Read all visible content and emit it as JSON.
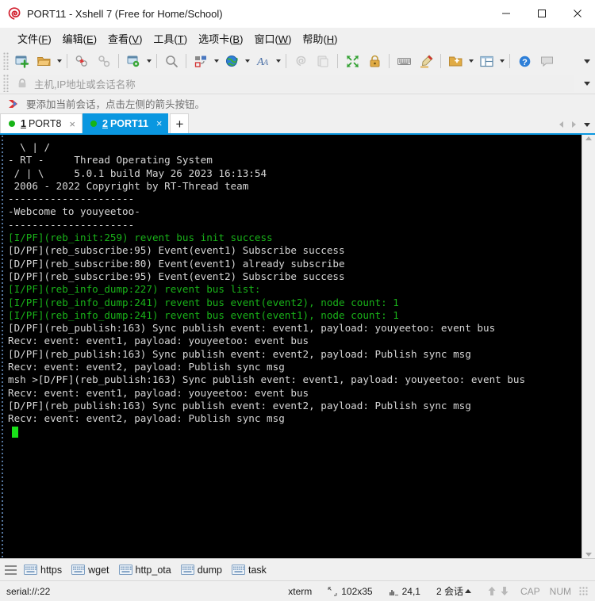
{
  "window": {
    "title": "PORT11 - Xshell 7 (Free for Home/School)",
    "app_icon": "xshell-spiral-icon",
    "controls": {
      "minimize": "minimize-button",
      "maximize": "maximize-button",
      "close": "close-button"
    }
  },
  "menubar": {
    "items": [
      {
        "label": "文件",
        "accel": "F"
      },
      {
        "label": "编辑",
        "accel": "E"
      },
      {
        "label": "查看",
        "accel": "V"
      },
      {
        "label": "工具",
        "accel": "T"
      },
      {
        "label": "选项卡",
        "accel": "B"
      },
      {
        "label": "窗口",
        "accel": "W"
      },
      {
        "label": "帮助",
        "accel": "H"
      }
    ]
  },
  "toolbar": {
    "buttons": [
      {
        "name": "new-session-icon",
        "has_caret": false
      },
      {
        "name": "open-folder-icon",
        "has_caret": true
      },
      {
        "name": "disconnect-icon",
        "has_caret": false
      },
      {
        "name": "reconnect-icon",
        "has_caret": false
      },
      {
        "name": "session-properties-icon",
        "has_caret": true
      },
      {
        "name": "find-icon",
        "has_caret": false
      },
      {
        "name": "transfer-file-icon",
        "has_caret": true
      },
      {
        "name": "globe-icon",
        "has_caret": true
      },
      {
        "name": "font-icon",
        "has_caret": true
      },
      {
        "name": "clear-screen-icon",
        "has_caret": false
      },
      {
        "name": "copy-paste-icon",
        "has_caret": false
      },
      {
        "name": "fullscreen-icon",
        "has_caret": false
      },
      {
        "name": "lock-icon",
        "has_caret": false
      },
      {
        "name": "keyboard-icon",
        "has_caret": false
      },
      {
        "name": "highlight-pen-icon",
        "has_caret": false
      },
      {
        "name": "new-folder-icon",
        "has_caret": true
      },
      {
        "name": "split-layout-icon",
        "has_caret": true
      },
      {
        "name": "help-icon",
        "has_caret": false
      },
      {
        "name": "chat-icon",
        "has_caret": false
      }
    ],
    "overflow": "toolbar-overflow-caret"
  },
  "addressbar": {
    "lock_icon": "lock-icon",
    "placeholder": "主机,IP地址或会话名称",
    "value": "",
    "overflow": "address-overflow-caret"
  },
  "hintbar": {
    "icon": "red-arrow-icon",
    "text": "要添加当前会话，点击左侧的箭头按钮。"
  },
  "tabs": {
    "items": [
      {
        "num": "1",
        "label": "PORT8",
        "active": false,
        "status": "connected"
      },
      {
        "num": "2",
        "label": "PORT11",
        "active": true,
        "status": "connected"
      }
    ],
    "add_label": "+",
    "close_label": "×",
    "nav": {
      "prev": "tab-prev-arrow",
      "next": "tab-next-arrow",
      "list": "tab-list-caret"
    }
  },
  "terminal": {
    "background": "#000000",
    "fg_white": "#d6d6d6",
    "fg_green": "#19b219",
    "cursor_color": "#19e019",
    "lines": [
      {
        "color": "white",
        "text": "  \\ | /"
      },
      {
        "color": "white",
        "text": "- RT -     Thread Operating System"
      },
      {
        "color": "white",
        "text": " / | \\     5.0.1 build May 26 2023 16:13:54"
      },
      {
        "color": "white",
        "text": " 2006 - 2022 Copyright by RT-Thread team"
      },
      {
        "color": "white",
        "text": "---------------------"
      },
      {
        "color": "white",
        "text": "-Webcome to youyeetoo-"
      },
      {
        "color": "white",
        "text": "---------------------"
      },
      {
        "color": "green",
        "text": "[I/PF](reb_init:259) revent bus init success"
      },
      {
        "color": "white",
        "text": "[D/PF](reb_subscribe:95) Event(event1) Subscribe success"
      },
      {
        "color": "white",
        "text": "[D/PF](reb_subscribe:80) Event(event1) already subscribe"
      },
      {
        "color": "white",
        "text": "[D/PF](reb_subscribe:95) Event(event2) Subscribe success"
      },
      {
        "color": "green",
        "text": "[I/PF](reb_info_dump:227) revent bus list:"
      },
      {
        "color": "green",
        "text": "[I/PF](reb_info_dump:241) revent bus event(event2), node count: 1"
      },
      {
        "color": "green",
        "text": "[I/PF](reb_info_dump:241) revent bus event(event1), node count: 1"
      },
      {
        "color": "white",
        "text": "[D/PF](reb_publish:163) Sync publish event: event1, payload: youyeetoo: event bus"
      },
      {
        "color": "white",
        "text": "Recv: event: event1, payload: youyeetoo: event bus"
      },
      {
        "color": "white",
        "text": "[D/PF](reb_publish:163) Sync publish event: event2, payload: Publish sync msg"
      },
      {
        "color": "white",
        "text": "Recv: event: event2, payload: Publish sync msg"
      },
      {
        "color": "white",
        "text": "msh >[D/PF](reb_publish:163) Sync publish event: event1, payload: youyeetoo: event bus"
      },
      {
        "color": "white",
        "text": "Recv: event: event1, payload: youyeetoo: event bus"
      },
      {
        "color": "white",
        "text": "[D/PF](reb_publish:163) Sync publish event: event2, payload: Publish sync msg"
      },
      {
        "color": "white",
        "text": "Recv: event: event2, payload: Publish sync msg"
      }
    ],
    "scrollbar": {
      "up": "scroll-up-arrow",
      "down": "scroll-down-arrow"
    }
  },
  "quickbar": {
    "menu_icon": "hamburger-menu-icon",
    "items": [
      {
        "icon": "keyboard-icon",
        "label": "https"
      },
      {
        "icon": "keyboard-icon",
        "label": "wget"
      },
      {
        "icon": "keyboard-icon",
        "label": "http_ota"
      },
      {
        "icon": "keyboard-icon",
        "label": "dump"
      },
      {
        "icon": "keyboard-icon",
        "label": "task"
      }
    ]
  },
  "statusbar": {
    "connection": "serial://:22",
    "terminal_type": "xterm",
    "size_icon": "screen-size-icon",
    "size": "102x35",
    "cursor_icon": "cursor-position-icon",
    "cursor_pos": "24,1",
    "sessions": "2 会话",
    "sessions_caret": "sessions-caret",
    "upload_icon": "upload-arrow-icon",
    "download_icon": "download-arrow-icon",
    "cap": "CAP",
    "num": "NUM",
    "resize_grip": "resize-grip"
  },
  "colors": {
    "accent": "#0a97e0",
    "chrome": "#f0f0f0",
    "terminal_bg": "#000000",
    "green": "#19b219",
    "tab_active_bg": "#0a97e0"
  }
}
